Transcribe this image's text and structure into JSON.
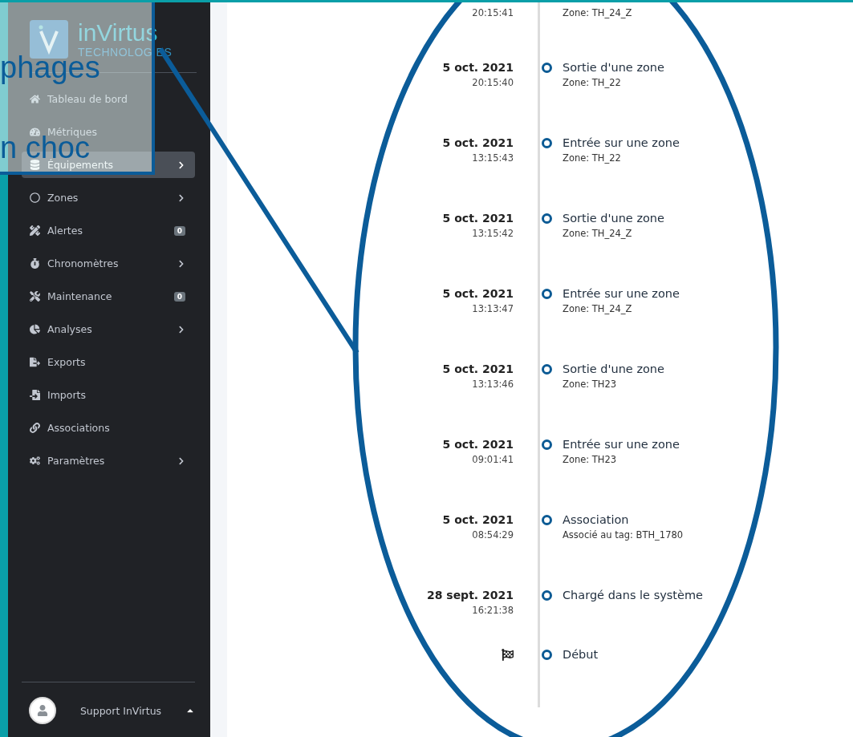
{
  "sidebar": {
    "logo": {
      "name": "inVirtus",
      "tagline": "TECHNOLOGIES"
    },
    "items": [
      {
        "label": "Tableau de bord",
        "selected": false,
        "expandable": false
      },
      {
        "label": "Métriques",
        "selected": false,
        "expandable": false
      },
      {
        "label": "Équipements",
        "selected": true,
        "expandable": true
      },
      {
        "label": "Zones",
        "selected": false,
        "expandable": true
      },
      {
        "label": "Alertes",
        "selected": false,
        "expandable": false,
        "badge": "0"
      },
      {
        "label": "Chronomètres",
        "selected": false,
        "expandable": true
      },
      {
        "label": "Maintenance",
        "selected": false,
        "expandable": false,
        "badge": "0"
      },
      {
        "label": "Analyses",
        "selected": false,
        "expandable": true
      },
      {
        "label": "Exports",
        "selected": false,
        "expandable": false
      },
      {
        "label": "Imports",
        "selected": false,
        "expandable": false
      },
      {
        "label": "Associations",
        "selected": false,
        "expandable": false
      },
      {
        "label": "Paramètres",
        "selected": false,
        "expandable": true
      }
    ],
    "user": {
      "name": "Support InVirtus",
      "expanded": false
    }
  },
  "timeline": {
    "events": [
      {
        "kind": "event",
        "time": "20:15:41",
        "detail": "Zone: TH_24_Z"
      },
      {
        "kind": "event",
        "date": "5 oct. 2021",
        "time": "20:15:40",
        "title": "Sortie d'une zone",
        "detail": "Zone: TH_22"
      },
      {
        "kind": "event",
        "date": "5 oct. 2021",
        "time": "13:15:43",
        "title": "Entrée sur une zone",
        "detail": "Zone: TH_22"
      },
      {
        "kind": "event",
        "date": "5 oct. 2021",
        "time": "13:15:42",
        "title": "Sortie d'une zone",
        "detail": "Zone: TH_24_Z"
      },
      {
        "kind": "event",
        "date": "5 oct. 2021",
        "time": "13:13:47",
        "title": "Entrée sur une zone",
        "detail": "Zone: TH_24_Z"
      },
      {
        "kind": "event",
        "date": "5 oct. 2021",
        "time": "13:13:46",
        "title": "Sortie d'une zone",
        "detail": "Zone: TH23"
      },
      {
        "kind": "event",
        "date": "5 oct. 2021",
        "time": "09:01:41",
        "title": "Entrée sur une zone",
        "detail": "Zone: TH23"
      },
      {
        "kind": "event",
        "date": "5 oct. 2021",
        "time": "08:54:29",
        "title": "Association",
        "detail": "Associé au tag: BTH_1780"
      },
      {
        "kind": "event",
        "date": "28 sept. 2021",
        "time": "16:21:38",
        "title": "Chargé dans le système"
      },
      {
        "kind": "start",
        "title": "Début"
      }
    ]
  },
  "annotation": {
    "texts": [
      "phages",
      "n choc"
    ]
  }
}
